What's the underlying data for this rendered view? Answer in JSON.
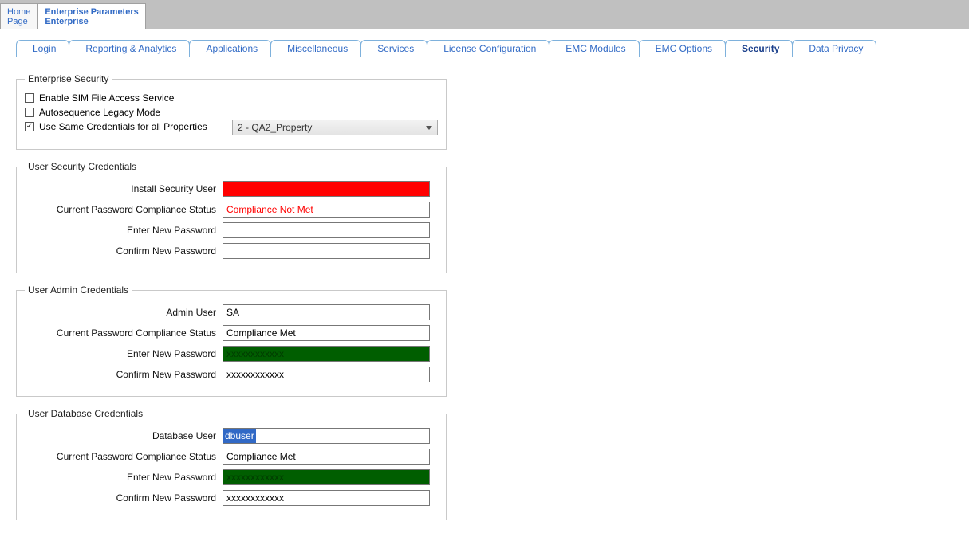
{
  "topTabs": {
    "home": {
      "l1": "Home",
      "l2": "Page"
    },
    "enterprise": {
      "l1": "Enterprise Parameters",
      "l2": "Enterprise"
    }
  },
  "subtabs": {
    "login": "Login",
    "reporting": "Reporting & Analytics",
    "applications": "Applications",
    "misc": "Miscellaneous",
    "services": "Services",
    "license": "License Configuration",
    "emcModules": "EMC Modules",
    "emcOptions": "EMC Options",
    "security": "Security",
    "dataPrivacy": "Data Privacy"
  },
  "enterpriseSecurity": {
    "legend": "Enterprise Security",
    "enableSim": "Enable SIM File Access Service",
    "autoLegacy": "Autosequence Legacy Mode",
    "sameCreds": "Use Same Credentials for all Properties",
    "propertyValue": "2 - QA2_Property"
  },
  "userSecurity": {
    "legend": "User Security Credentials",
    "installUserLabel": "Install Security User",
    "installUserValue": "",
    "complianceLabel": "Current Password Compliance Status",
    "complianceValue": "Compliance Not Met",
    "newPassLabel": "Enter New Password",
    "confirmPassLabel": "Confirm New Password"
  },
  "userAdmin": {
    "legend": "User Admin Credentials",
    "adminUserLabel": "Admin User",
    "adminUserValue": "SA",
    "complianceLabel": "Current Password Compliance Status",
    "complianceValue": "Compliance Met",
    "newPassLabel": "Enter New Password",
    "newPassValue": "xxxxxxxxxxxx",
    "confirmPassLabel": "Confirm New Password",
    "confirmPassValue": "xxxxxxxxxxxx"
  },
  "userDb": {
    "legend": "User Database Credentials",
    "dbUserLabel": "Database User",
    "dbUserValue": "dbuser",
    "complianceLabel": "Current Password Compliance Status",
    "complianceValue": "Compliance Met",
    "newPassLabel": "Enter New  Password",
    "newPassValue": "xxxxxxxxxxxx",
    "confirmPassLabel": "Confirm New Password",
    "confirmPassValue": "xxxxxxxxxxxx"
  }
}
